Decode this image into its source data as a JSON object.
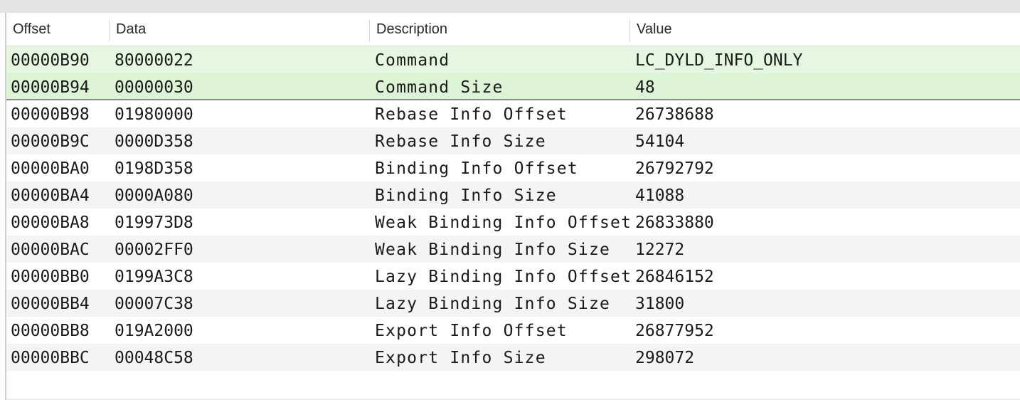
{
  "columns": {
    "offset": "Offset",
    "data": "Data",
    "description": "Description",
    "value": "Value"
  },
  "rows": [
    {
      "offset": "00000B90",
      "data": "80000022",
      "description": "Command",
      "value": "LC_DYLD_INFO_ONLY",
      "selected": true
    },
    {
      "offset": "00000B94",
      "data": "00000030",
      "description": "Command Size",
      "value": "48",
      "selected": true
    },
    {
      "offset": "00000B98",
      "data": "01980000",
      "description": "Rebase Info Offset",
      "value": "26738688",
      "selected": false
    },
    {
      "offset": "00000B9C",
      "data": "0000D358",
      "description": "Rebase Info Size",
      "value": "54104",
      "selected": false
    },
    {
      "offset": "00000BA0",
      "data": "0198D358",
      "description": "Binding Info Offset",
      "value": "26792792",
      "selected": false
    },
    {
      "offset": "00000BA4",
      "data": "0000A080",
      "description": "Binding Info Size",
      "value": "41088",
      "selected": false
    },
    {
      "offset": "00000BA8",
      "data": "019973D8",
      "description": "Weak Binding Info Offset",
      "value": "26833880",
      "selected": false
    },
    {
      "offset": "00000BAC",
      "data": "00002FF0",
      "description": "Weak Binding Info Size",
      "value": "12272",
      "selected": false
    },
    {
      "offset": "00000BB0",
      "data": "0199A3C8",
      "description": "Lazy Binding Info Offset",
      "value": "26846152",
      "selected": false
    },
    {
      "offset": "00000BB4",
      "data": "00007C38",
      "description": "Lazy Binding Info Size",
      "value": "31800",
      "selected": false
    },
    {
      "offset": "00000BB8",
      "data": "019A2000",
      "description": "Export Info Offset",
      "value": "26877952",
      "selected": false
    },
    {
      "offset": "00000BBC",
      "data": "00048C58",
      "description": "Export Info Size",
      "value": "298072",
      "selected": false
    }
  ],
  "colors": {
    "selection": "#e5f7e1",
    "selection_alt": "#dcf3d6",
    "stripe": "#f4f4f4"
  }
}
